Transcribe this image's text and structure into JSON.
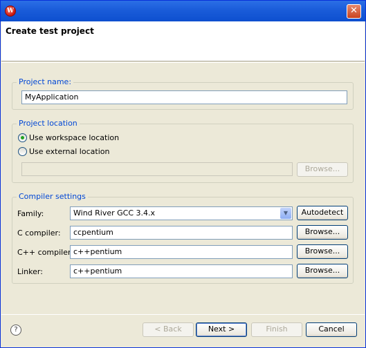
{
  "window": {
    "title": "",
    "close_label": "✕",
    "app_icon_letter": "W"
  },
  "banner": {
    "title": "Create test project"
  },
  "project_name": {
    "legend": "Project name:",
    "value": "MyApplication"
  },
  "project_location": {
    "legend": "Project location",
    "option_workspace": "Use workspace location",
    "option_external": "Use external location",
    "path_value": "",
    "browse_label": "Browse..."
  },
  "compiler_settings": {
    "legend": "Compiler settings",
    "family_label": "Family:",
    "family_value": "Wind River GCC 3.4.x",
    "autodetect_label": "Autodetect",
    "c_compiler_label": "C compiler:",
    "c_compiler_value": "ccpentium",
    "cpp_compiler_label": "C++ compiler:",
    "cpp_compiler_value": "c++pentium",
    "linker_label": "Linker:",
    "linker_value": "c++pentium",
    "browse_label": "Browse..."
  },
  "footer": {
    "help_icon": "?",
    "back_label": "< Back",
    "next_label": "Next >",
    "finish_label": "Finish",
    "cancel_label": "Cancel"
  },
  "colors": {
    "titlebar": "#0d4fcf",
    "legend_text": "#0046d5",
    "window_bg": "#ece9d8"
  }
}
